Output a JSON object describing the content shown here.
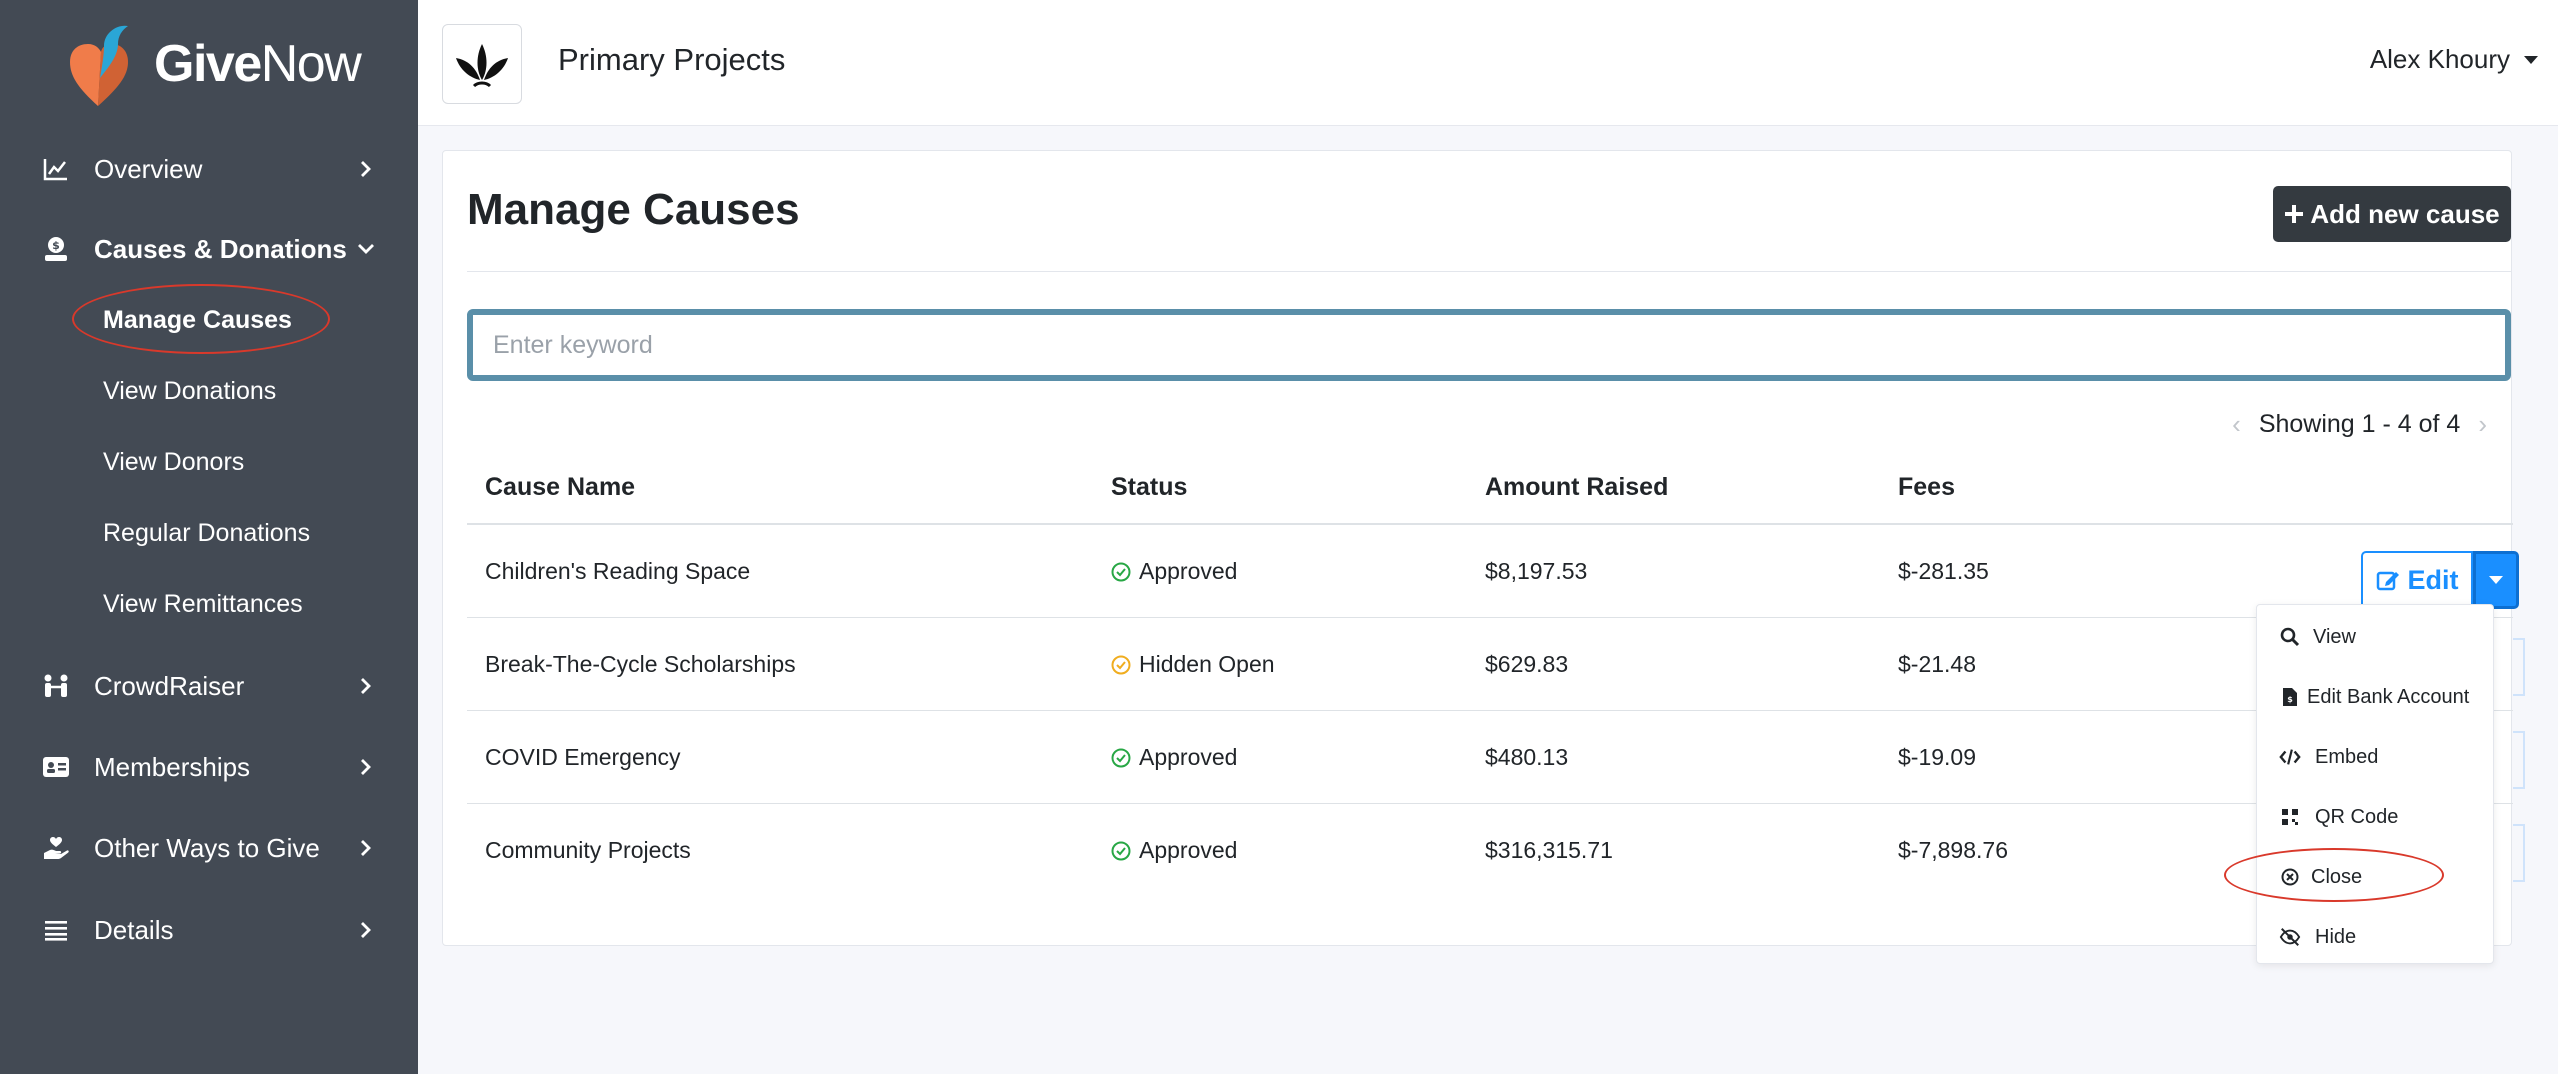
{
  "brand": {
    "name_part1": "Give",
    "name_part2": "Now"
  },
  "sidebar": {
    "items": [
      {
        "label": "Overview",
        "icon": "chart-line-icon"
      },
      {
        "label": "Causes & Donations",
        "icon": "money-hand-icon"
      },
      {
        "label": "CrowdRaiser",
        "icon": "people-icon"
      },
      {
        "label": "Memberships",
        "icon": "id-card-icon"
      },
      {
        "label": "Other Ways to Give",
        "icon": "hand-heart-icon"
      },
      {
        "label": "Details",
        "icon": "list-icon"
      }
    ],
    "subitems": [
      {
        "label": "Manage Causes"
      },
      {
        "label": "View Donations"
      },
      {
        "label": "View Donors"
      },
      {
        "label": "Regular Donations"
      },
      {
        "label": "View Remittances"
      }
    ]
  },
  "header": {
    "org_name": "Primary Projects",
    "user_name": "Alex Khoury"
  },
  "main": {
    "title": "Manage Causes",
    "add_button": "Add new cause",
    "search_placeholder": "Enter keyword",
    "pagination": "Showing 1 - 4 of 4",
    "columns": [
      "Cause Name",
      "Status",
      "Amount Raised",
      "Fees"
    ],
    "rows": [
      {
        "name": "Children's Reading Space",
        "status": "Approved",
        "amount": "$8,197.53",
        "fees": "$-281.35"
      },
      {
        "name": "Break-The-Cycle Scholarships",
        "status": "Hidden Open",
        "amount": "$629.83",
        "fees": "$-21.48"
      },
      {
        "name": "COVID Emergency",
        "status": "Approved",
        "amount": "$480.13",
        "fees": "$-19.09"
      },
      {
        "name": "Community Projects",
        "status": "Approved",
        "amount": "$316,315.71",
        "fees": "$-7,898.76"
      }
    ],
    "edit_label": "Edit"
  },
  "dropdown": {
    "items": [
      {
        "label": "View",
        "icon": "search-icon"
      },
      {
        "label": "Edit Bank Account",
        "icon": "file-icon"
      },
      {
        "label": "Embed",
        "icon": "code-icon"
      },
      {
        "label": "QR Code",
        "icon": "qr-code-icon"
      },
      {
        "label": "Close",
        "icon": "circle-x-icon"
      },
      {
        "label": "Hide",
        "icon": "eye-slash-icon"
      }
    ]
  },
  "colors": {
    "sidebar_bg": "#434a54",
    "accent_blue": "#1a8fff",
    "approved_green": "#28a745",
    "hidden_yellow": "#f0ad1f",
    "annotation_red": "#d9392b",
    "search_border": "#5a8fa9"
  }
}
